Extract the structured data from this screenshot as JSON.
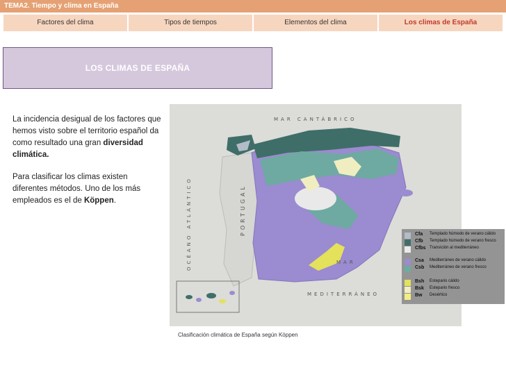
{
  "header": {
    "title": "TEMA2. Tiempo y clima en España"
  },
  "tabs": [
    {
      "label": "Factores del clima"
    },
    {
      "label": "Tipos de tiempos"
    },
    {
      "label": "Elementos del clima"
    },
    {
      "label": "Los climas de España"
    }
  ],
  "section_title": "LOS CLIMAS DE ESPAÑA",
  "body": {
    "p1_text": "La incidencia desigual de los factores que hemos visto sobre el territorio español da como resultado una gran",
    "p1_bold": "diversidad climática.",
    "p2_text": "Para clasificar los climas existen diferentes métodos. Uno de los más empleados es el de",
    "p2_bold": "Köppen",
    "p2_end": "."
  },
  "map": {
    "label_cantabrico": "MAR CANTÁBRICO",
    "label_mediterraneo_1": "MAR",
    "label_mediterraneo_2": "MEDITERRÁNEO",
    "label_atlantico": "OCÉANO ATLÁNTICO",
    "label_portugal": "PORTUGAL",
    "caption": "Clasificación climática de España según Köppen"
  },
  "legend": [
    {
      "code": "Cfa",
      "desc": "Templado húmedo de verano cálido",
      "color": "#b4bcc8"
    },
    {
      "code": "Cfb",
      "desc": "Templado húmedo de verano fresco",
      "color": "#3f6e68"
    },
    {
      "code": "Cfbs",
      "desc": "Transición al mediterráneo",
      "color": "#e9e9e9"
    },
    {
      "code": "Csa",
      "desc": "Mediterráneo de verano cálido",
      "color": "#9b8bd0"
    },
    {
      "code": "Csb",
      "desc": "Mediterráneo de verano fresco",
      "color": "#6eaaa1"
    },
    {
      "code": "Bsh",
      "desc": "Estepario cálido",
      "color": "#e4e15b"
    },
    {
      "code": "Bsk",
      "desc": "Estepario fresco",
      "color": "#f0eec0"
    },
    {
      "code": "Bw",
      "desc": "Desértico",
      "color": "#f2ee85"
    }
  ],
  "colors": {
    "header_bg": "#e5a173",
    "tab_bg": "#f7d6c0",
    "active_tab": "#c0392b",
    "title_box_bg": "#d5c8dd"
  }
}
